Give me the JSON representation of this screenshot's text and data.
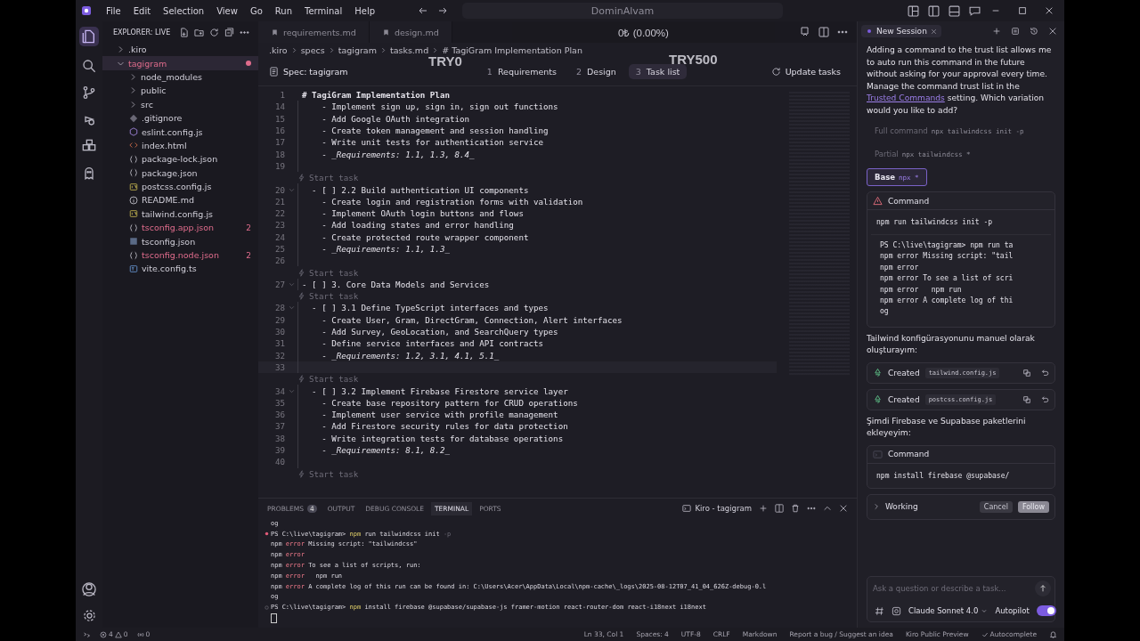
{
  "window": {
    "title": "DominAlvam",
    "menu": [
      "File",
      "Edit",
      "Selection",
      "View",
      "Go",
      "Run",
      "Terminal",
      "Help"
    ]
  },
  "overlay": {
    "balance": "0₺ (0.00%)",
    "left_label": "TRY0",
    "right_label": "TRY500"
  },
  "explorer": {
    "title": "EXPLORER: LIVE",
    "tree": [
      {
        "label": ".kiro",
        "kind": "folder",
        "expanded": false,
        "selected": false,
        "error": false
      },
      {
        "label": "tagigram",
        "kind": "folder",
        "expanded": true,
        "selected": true,
        "error": true,
        "children": [
          {
            "label": "node_modules",
            "kind": "folder",
            "expanded": false,
            "selected": false,
            "error": false
          },
          {
            "label": "public",
            "kind": "folder",
            "expanded": false,
            "selected": false,
            "error": false
          },
          {
            "label": "src",
            "kind": "folder",
            "expanded": false,
            "selected": false,
            "error": false
          },
          {
            "label": ".gitignore",
            "kind": "git",
            "selected": false,
            "error": false
          },
          {
            "label": "eslint.config.js",
            "kind": "eslint",
            "selected": false,
            "error": false
          },
          {
            "label": "index.html",
            "kind": "html",
            "selected": false,
            "error": false
          },
          {
            "label": "package-lock.json",
            "kind": "json",
            "selected": false,
            "error": false
          },
          {
            "label": "package.json",
            "kind": "json",
            "selected": false,
            "error": false
          },
          {
            "label": "postcss.config.js",
            "kind": "js",
            "selected": false,
            "error": false
          },
          {
            "label": "README.md",
            "kind": "info",
            "selected": false,
            "error": false
          },
          {
            "label": "tailwind.config.js",
            "kind": "js",
            "selected": false,
            "error": false
          },
          {
            "label": "tsconfig.app.json",
            "kind": "json",
            "selected": false,
            "error": true,
            "badge": "2"
          },
          {
            "label": "tsconfig.json",
            "kind": "tsjson",
            "selected": false,
            "error": false
          },
          {
            "label": "tsconfig.node.json",
            "kind": "json",
            "selected": false,
            "error": true,
            "badge": "2"
          },
          {
            "label": "vite.config.ts",
            "kind": "ts",
            "selected": false,
            "error": false
          }
        ]
      }
    ]
  },
  "editor": {
    "tabs": [
      {
        "label": "requirements.md",
        "selected": false
      },
      {
        "label": "design.md",
        "selected": false
      }
    ],
    "breadcrumb": [
      ".kiro",
      "specs",
      "tagigram",
      "tasks.md",
      "# TagiGram Implementation Plan"
    ],
    "spec": {
      "title": "Spec: tagigram",
      "steps": [
        {
          "num": "1",
          "label": "Requirements",
          "selected": false
        },
        {
          "num": "2",
          "label": "Design",
          "selected": false
        },
        {
          "num": "3",
          "label": "Task list",
          "selected": true
        }
      ],
      "action": "Update tasks"
    },
    "lines": [
      {
        "kind": "heading",
        "num": "1",
        "text": "# TagiGram Implementation Plan"
      },
      {
        "kind": "line",
        "num": "14",
        "text": "    - Implement sign up, sign in, sign out functions"
      },
      {
        "kind": "line",
        "num": "15",
        "text": "    - Add Google OAuth integration"
      },
      {
        "kind": "line",
        "num": "16",
        "text": "    - Create token management and session handling"
      },
      {
        "kind": "line",
        "num": "17",
        "text": "    - Write unit tests for authentication service"
      },
      {
        "kind": "line",
        "num": "18",
        "text": "    - *_Requirements: 1.1, 1.3, 8.4_*"
      },
      {
        "kind": "line",
        "num": "19"
      },
      {
        "kind": "lens",
        "text": "Start task"
      },
      {
        "kind": "line",
        "num": "20",
        "fold": true,
        "text": "  - [ ] 2.2 Build authentication UI components"
      },
      {
        "kind": "line",
        "num": "21",
        "text": "    - Create login and registration forms with validation"
      },
      {
        "kind": "line",
        "num": "22",
        "text": "    - Implement OAuth login buttons and flows"
      },
      {
        "kind": "line",
        "num": "23",
        "text": "    - Add loading states and error handling"
      },
      {
        "kind": "line",
        "num": "24",
        "text": "    - Create protected route wrapper component"
      },
      {
        "kind": "line",
        "num": "25",
        "text": "    - *_Requirements: 1.1, 1.3_*"
      },
      {
        "kind": "line",
        "num": "26"
      },
      {
        "kind": "lens",
        "text": "Start task"
      },
      {
        "kind": "line",
        "num": "27",
        "fold": true,
        "text": "- [ ] 3. Core Data Models and Services"
      },
      {
        "kind": "lens",
        "text": "Start task"
      },
      {
        "kind": "line",
        "num": "28",
        "fold": true,
        "text": "  - [ ] 3.1 Define TypeScript interfaces and types"
      },
      {
        "kind": "line",
        "num": "29",
        "text": "    - Create User, Gram, DirectGram, Connection, Alert interfaces"
      },
      {
        "kind": "line",
        "num": "30",
        "text": "    - Add Survey, GeoLocation, and SearchQuery types"
      },
      {
        "kind": "line",
        "num": "31",
        "text": "    - Define service interfaces and API contracts"
      },
      {
        "kind": "line",
        "num": "32",
        "text": "    - *_Requirements: 1.2, 3.1, 4.1, 5.1_*"
      },
      {
        "kind": "line",
        "num": "33",
        "current": true
      },
      {
        "kind": "lens",
        "text": "Start task"
      },
      {
        "kind": "line",
        "num": "34",
        "fold": true,
        "text": "  - [ ] 3.2 Implement Firebase Firestore service layer"
      },
      {
        "kind": "line",
        "num": "35",
        "text": "    - Create base repository pattern for CRUD operations"
      },
      {
        "kind": "line",
        "num": "36",
        "text": "    - Implement user service with profile management"
      },
      {
        "kind": "line",
        "num": "37",
        "text": "    - Add Firestore security rules for data protection"
      },
      {
        "kind": "line",
        "num": "38",
        "text": "    - Write integration tests for database operations"
      },
      {
        "kind": "line",
        "num": "39",
        "text": "    - *_Requirements: 8.1, 8.2_*"
      },
      {
        "kind": "line",
        "num": "40"
      },
      {
        "kind": "lens",
        "text": "Start task"
      }
    ]
  },
  "panel": {
    "tabs": [
      {
        "label": "PROBLEMS",
        "badge": "4",
        "selected": false
      },
      {
        "label": "OUTPUT",
        "selected": false
      },
      {
        "label": "DEBUG CONSOLE",
        "selected": false
      },
      {
        "label": "TERMINAL",
        "selected": true
      },
      {
        "label": "PORTS",
        "selected": false
      }
    ],
    "terminal_name": "Kiro - tagigram",
    "lines": [
      {
        "parts": [
          {
            "kind": "plain",
            "text": "og"
          }
        ]
      },
      {
        "failed": true,
        "parts": [
          {
            "kind": "plain",
            "text": "PS C:\\live\\tagigram> "
          },
          {
            "kind": "cmd",
            "text": "npm"
          },
          {
            "kind": "plain",
            "text": " run tailwindcss init "
          },
          {
            "kind": "dim",
            "text": "-p"
          }
        ]
      },
      {
        "parts": [
          {
            "kind": "plain",
            "text": "npm "
          },
          {
            "kind": "error",
            "text": "error"
          },
          {
            "kind": "plain",
            "text": " Missing script: \"tailwindcss\""
          }
        ]
      },
      {
        "parts": [
          {
            "kind": "plain",
            "text": "npm "
          },
          {
            "kind": "error",
            "text": "error"
          }
        ]
      },
      {
        "parts": [
          {
            "kind": "plain",
            "text": "npm "
          },
          {
            "kind": "error",
            "text": "error"
          },
          {
            "kind": "plain",
            "text": " To see a list of scripts, run:"
          }
        ]
      },
      {
        "parts": [
          {
            "kind": "plain",
            "text": "npm "
          },
          {
            "kind": "error",
            "text": "error"
          },
          {
            "kind": "plain",
            "text": "   npm run"
          }
        ]
      },
      {
        "parts": [
          {
            "kind": "plain",
            "text": "npm "
          },
          {
            "kind": "error",
            "text": "error"
          },
          {
            "kind": "plain",
            "text": " A complete log of this run can be found in: C:\\Users\\Acer\\AppData\\Local\\npm-cache\\_logs\\2025-08-12T07_41_04_626Z-debug-0.l"
          }
        ]
      },
      {
        "parts": [
          {
            "kind": "plain",
            "text": "og"
          }
        ]
      },
      {
        "failed": false,
        "parts": [
          {
            "kind": "plain",
            "text": "PS C:\\live\\tagigram> "
          },
          {
            "kind": "cmd",
            "text": "npm"
          },
          {
            "kind": "plain",
            "text": " install firebase @supabase/supabase-js framer-motion react-router-dom react-i18next i18next"
          }
        ]
      }
    ]
  },
  "chat": {
    "tab": "New Session",
    "intro": {
      "text": "Adding a command to the trust list allows me to auto run this command in the future without asking for your approval every time. Manage the command trust list in the ",
      "link": "Trusted Commands",
      "text_after": " setting. Which variation would you like to add?"
    },
    "options": [
      {
        "label": "Full command",
        "code": "npx tailwindcss init -p",
        "selected": false
      },
      {
        "label": "Partial",
        "code": "npx tailwindcss *",
        "selected": false
      },
      {
        "label": "Base",
        "code": "npx *",
        "selected": true
      }
    ],
    "items": [
      {
        "kind": "command",
        "warning": true,
        "title": "Command",
        "command": "npm run tailwindcss init -p",
        "output": [
          "PS C:\\live\\tagigram> npm run ta",
          "npm error Missing script: \"tail",
          "npm error",
          "npm error To see a list of scri",
          "npm error   npm run",
          "npm error A complete log of thi",
          "og"
        ]
      },
      {
        "kind": "text",
        "text": "Tailwind konfigürasyonunu manuel olarak oluşturayım:"
      },
      {
        "kind": "created",
        "label": "Created",
        "file": "tailwind.config.js"
      },
      {
        "kind": "created",
        "label": "Created",
        "file": "postcss.config.js"
      },
      {
        "kind": "text",
        "text": "Şimdi Firebase ve Supabase paketlerini ekleyeyim:"
      },
      {
        "kind": "command",
        "warning": false,
        "title": "Command",
        "command": "npm install firebase @supabase/"
      },
      {
        "kind": "working",
        "label": "Working",
        "buttons": [
          "Cancel",
          "Follow"
        ]
      }
    ],
    "input": {
      "placeholder": "Ask a question or describe a task..."
    },
    "model": "Claude Sonnet 4.0",
    "autopilot": {
      "label": "Autopilot",
      "on": true
    }
  },
  "status_bar": {
    "errors": "4",
    "warnings": "0",
    "ports": "0",
    "right": [
      "Ln 33, Col 1",
      "Spaces: 4",
      "UTF-8",
      "CRLF",
      "Markdown",
      "Report a bug / Suggest an idea",
      "Kiro Public Preview"
    ],
    "autocomplete": "Autocomplete"
  }
}
